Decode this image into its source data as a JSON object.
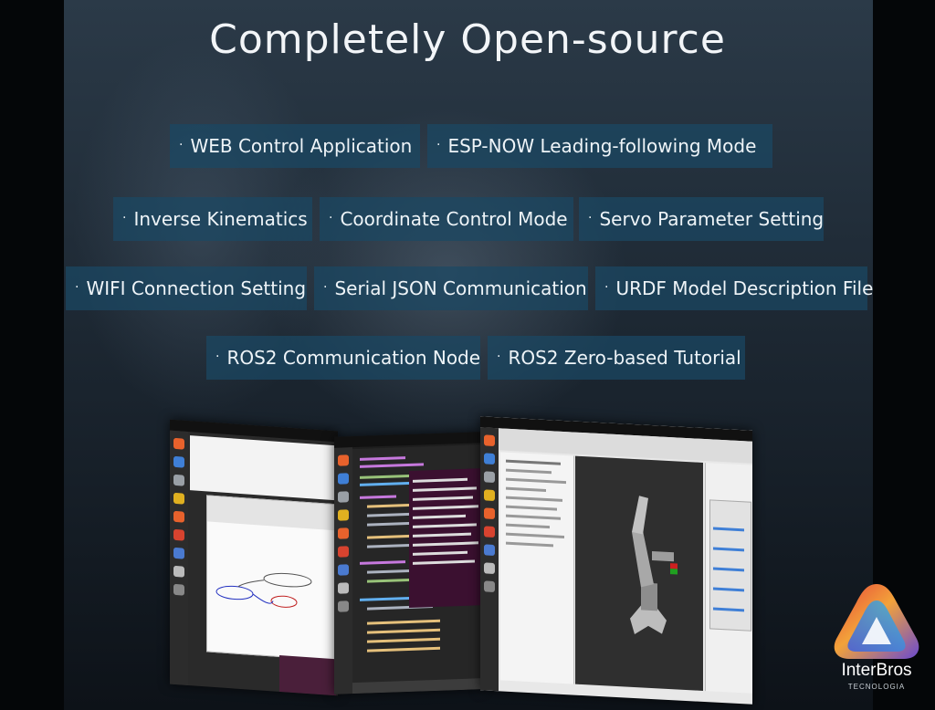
{
  "title": "Completely Open-source",
  "bullet": "·",
  "features": [
    "WEB Control Application",
    "ESP-NOW Leading-following Mode",
    "Inverse Kinematics",
    "Coordinate Control Mode",
    "Servo Parameter Setting",
    "WIFI Connection Setting",
    "Serial JSON Communication",
    "URDF Model Description File",
    "ROS2 Communication Node",
    "ROS2 Zero-based Tutorial"
  ],
  "brand": {
    "name": "InterBros",
    "tagline": "TECNOLOGIA",
    "colors": [
      "#e8433a",
      "#f2a23a",
      "#3fb6d8",
      "#6a4ad0"
    ]
  },
  "colors": {
    "tag_background": "#1a4864",
    "title_text": "#f2f5f8"
  }
}
